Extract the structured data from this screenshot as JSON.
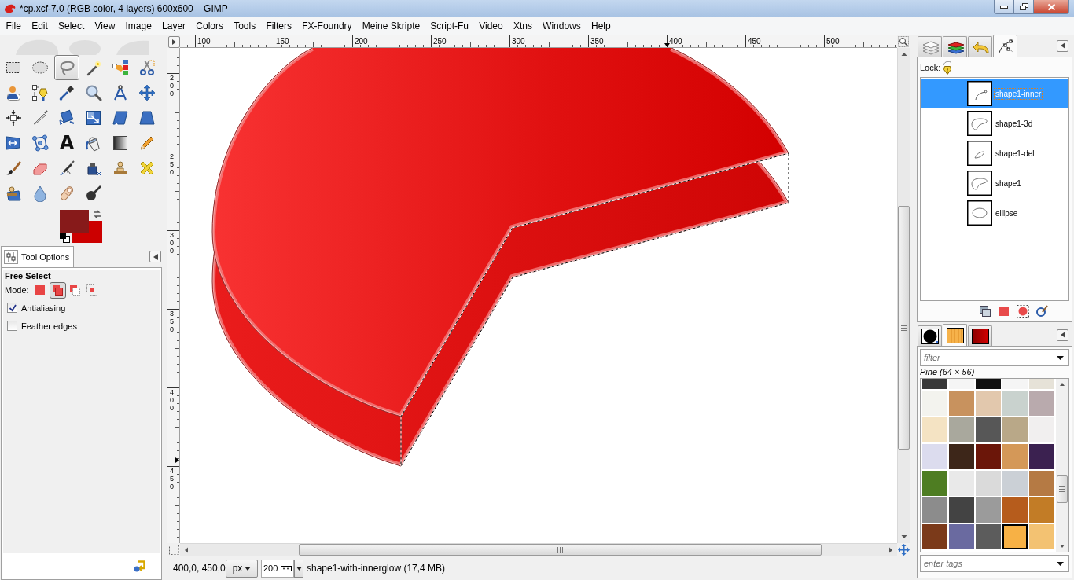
{
  "window": {
    "title": "*cp.xcf-7.0 (RGB color, 4 layers) 600x600 – GIMP"
  },
  "menu_bar": [
    "File",
    "Edit",
    "Select",
    "View",
    "Image",
    "Layer",
    "Colors",
    "Tools",
    "Filters",
    "FX-Foundry",
    "Meine Skripte",
    "Script-Fu",
    "Video",
    "Xtns",
    "Windows",
    "Help"
  ],
  "toolbox": {
    "tools": [
      {
        "kind": "rectangle",
        "selected": false
      },
      {
        "kind": "ellipse",
        "selected": false
      },
      {
        "kind": "lasso",
        "selected": true
      },
      {
        "kind": "wand",
        "selected": false
      },
      {
        "kind": "bycolor",
        "selected": false
      },
      {
        "kind": "scissors",
        "selected": false
      },
      {
        "kind": "foreground",
        "selected": false
      },
      {
        "kind": "paths",
        "selected": false
      },
      {
        "kind": "picker",
        "selected": false
      },
      {
        "kind": "zoom",
        "selected": false
      },
      {
        "kind": "measure",
        "selected": false
      },
      {
        "kind": "move",
        "selected": false
      },
      {
        "kind": "align",
        "selected": false
      },
      {
        "kind": "crop",
        "selected": false
      },
      {
        "kind": "rotate",
        "selected": false
      },
      {
        "kind": "scale",
        "selected": false
      },
      {
        "kind": "shear",
        "selected": false
      },
      {
        "kind": "perspective",
        "selected": false
      },
      {
        "kind": "flip",
        "selected": false
      },
      {
        "kind": "cage",
        "selected": false
      },
      {
        "kind": "text",
        "glyph": "A",
        "selected": false
      },
      {
        "kind": "bucket",
        "selected": false
      },
      {
        "kind": "blend",
        "selected": false
      },
      {
        "kind": "pencil",
        "selected": false
      },
      {
        "kind": "brush",
        "selected": false
      },
      {
        "kind": "eraser",
        "selected": false
      },
      {
        "kind": "airbrush",
        "selected": false
      },
      {
        "kind": "ink",
        "selected": false
      },
      {
        "kind": "clone",
        "selected": false
      },
      {
        "kind": "heal",
        "selected": false
      },
      {
        "kind": "perspectiveclone",
        "selected": false
      },
      {
        "kind": "blur",
        "selected": false
      },
      {
        "kind": "smudge",
        "selected": false
      },
      {
        "kind": "dodge",
        "selected": false
      }
    ],
    "colors": [
      {
        "kind": "foreground",
        "color": "#871a1a"
      },
      {
        "kind": "background",
        "color": "#cc0000"
      }
    ]
  },
  "tool_options": {
    "tab_label": "Tool Options",
    "tool_name": "Free Select",
    "mode_label": "Mode:",
    "modes": [
      {
        "kind": "replace",
        "selected": false
      },
      {
        "kind": "add",
        "selected": true
      },
      {
        "kind": "subtract",
        "selected": false
      },
      {
        "kind": "intersect",
        "selected": false
      }
    ],
    "options": [
      {
        "label": "Antialiasing",
        "checked": true
      },
      {
        "label": "Feather edges",
        "checked": false
      }
    ]
  },
  "image_window": {
    "horizontal_ruler": [
      "100",
      "150",
      "200",
      "250",
      "300",
      "350",
      "400",
      "450",
      "500"
    ],
    "vertical_ruler": [
      "200",
      "250",
      "300",
      "350",
      "400",
      "450"
    ],
    "status_bar": {
      "coordinates": "400,0, 450,0",
      "unit": "px",
      "zoom": "200",
      "message": "shape1-with-innerglow (17,4 MB)"
    }
  },
  "paths_dock": {
    "tabs": [
      {
        "kind": "layers",
        "selected": false
      },
      {
        "kind": "channels",
        "selected": false
      },
      {
        "kind": "undo",
        "selected": false
      },
      {
        "kind": "paths",
        "selected": true
      }
    ],
    "lock_label": "Lock:",
    "paths": [
      {
        "name": "shape1-inner",
        "kind": "curve",
        "selected": true
      },
      {
        "name": "shape1-3d",
        "kind": "blob",
        "selected": false
      },
      {
        "name": "shape1-del",
        "kind": "leaf",
        "selected": false
      },
      {
        "name": "shape1",
        "kind": "blob",
        "selected": false
      },
      {
        "name": "ellipse",
        "kind": "ellipse",
        "selected": false
      }
    ]
  },
  "patterns_dock": {
    "tabs": [
      {
        "kind": "brushes",
        "selected": false
      },
      {
        "kind": "patterns",
        "selected": true
      },
      {
        "kind": "gradients",
        "selected": false
      }
    ],
    "filter": {
      "placeholder": "filter"
    },
    "selection_label": "Pine (64 × 56)",
    "patterns": [
      {
        "color": "#383838",
        "selected": false
      },
      {
        "color": "#f5f5f5",
        "selected": false
      },
      {
        "color": "#101010",
        "selected": false
      },
      {
        "color": "#f5f5f5",
        "selected": false
      },
      {
        "color": "#e6e2d8",
        "selected": false
      },
      {
        "color": "#f3f3ee",
        "selected": false
      },
      {
        "color": "#c8925e",
        "selected": false
      },
      {
        "color": "#e2c8ad",
        "selected": false
      },
      {
        "color": "#c9d2ce",
        "selected": false
      },
      {
        "color": "#b9aaad",
        "selected": false
      },
      {
        "color": "#f4e3c3",
        "selected": false
      },
      {
        "color": "#a9a89d",
        "selected": false
      },
      {
        "color": "#575757",
        "selected": false
      },
      {
        "color": "#b9a888",
        "selected": false
      },
      {
        "color": "#f1efef",
        "selected": false
      },
      {
        "color": "#dcdcee",
        "selected": false
      },
      {
        "color": "#3d2619",
        "selected": false
      },
      {
        "color": "#6b1609",
        "selected": false
      },
      {
        "color": "#d49858",
        "selected": false
      },
      {
        "color": "#3b2150",
        "selected": false
      },
      {
        "color": "#4e7d22",
        "selected": false
      },
      {
        "color": "#e9e9e9",
        "selected": false
      },
      {
        "color": "#dadada",
        "selected": false
      },
      {
        "color": "#cbd0d6",
        "selected": false
      },
      {
        "color": "#b57a44",
        "selected": false
      },
      {
        "color": "#8c8c8c",
        "selected": false
      },
      {
        "color": "#434343",
        "selected": false
      },
      {
        "color": "#9b9b9b",
        "selected": false
      },
      {
        "color": "#b65c1c",
        "selected": false
      },
      {
        "color": "#c27c26",
        "selected": false
      },
      {
        "color": "#7b3a1a",
        "selected": false
      },
      {
        "color": "#6a6aa0",
        "selected": false
      },
      {
        "color": "#5c5c5c",
        "selected": false
      },
      {
        "color": "#f7b145",
        "selected": true
      },
      {
        "color": "#f3c272",
        "selected": false
      }
    ],
    "tags": {
      "placeholder": "enter tags"
    }
  }
}
